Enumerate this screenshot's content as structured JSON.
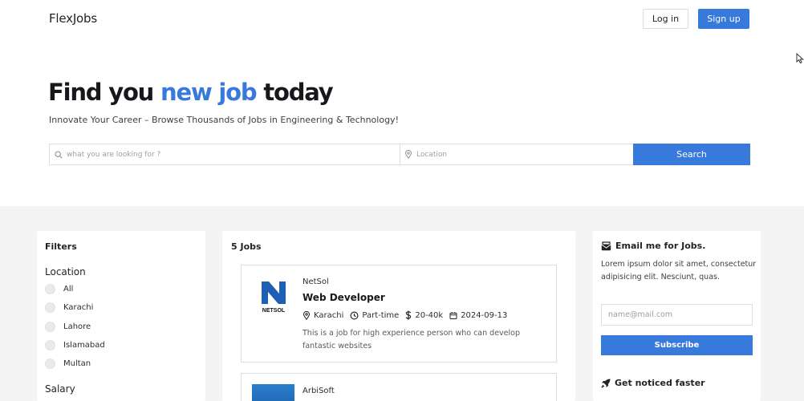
{
  "header": {
    "logo": "FlexJobs",
    "login_label": "Log in",
    "signup_label": "Sign up"
  },
  "hero": {
    "title_part1": "Find you ",
    "title_accent": "new job",
    "title_part2": " today",
    "subtitle": "Innovate Your Career – Browse Thousands of Jobs in Engineering & Technology!"
  },
  "search": {
    "query_placeholder": "what you are looking for ?",
    "query_value": "",
    "location_placeholder": "Location",
    "location_value": "",
    "button_label": "Search"
  },
  "filters": {
    "title": "Filters",
    "location_heading": "Location",
    "locations": [
      "All",
      "Karachi",
      "Lahore",
      "Islamabad",
      "Multan"
    ],
    "salary_heading": "Salary"
  },
  "jobs": {
    "count_label": "5 Jobs",
    "items": [
      {
        "company": "NetSol",
        "logo_text": "NETSOL",
        "title": "Web Developer",
        "location": "Karachi",
        "type": "Part-time",
        "salary": "20-40k",
        "date": "2024-09-13",
        "description": "This is a job for high experience person who can develop fantastic websites"
      },
      {
        "company": "ArbiSoft"
      }
    ]
  },
  "sidebar": {
    "email_title": "Email me for Jobs.",
    "email_text": "Lorem ipsum dolor sit amet, consectetur adipisicing elit. Nesciunt, quas.",
    "email_placeholder": "name@mail.com",
    "email_value": "",
    "subscribe_label": "Subscribe",
    "noticed_title": "Get noticed faster"
  },
  "colors": {
    "accent": "#3879dc",
    "section_bg": "#f4f4f5",
    "netsol_blue": "#1f5fb3"
  }
}
